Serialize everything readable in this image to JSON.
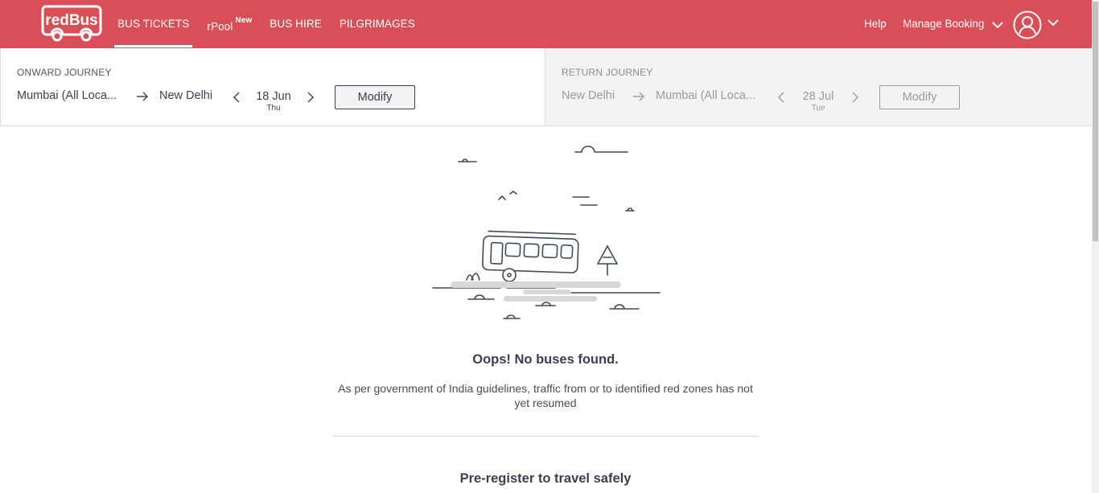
{
  "brand": {
    "logo_text": "redBus",
    "header_color": "#d84f57"
  },
  "nav": {
    "items": [
      {
        "label": "BUS TICKETS",
        "active": true
      },
      {
        "label": "rPool",
        "badge": "New",
        "active": false
      },
      {
        "label": "BUS HIRE",
        "active": false
      },
      {
        "label": "PILGRIMAGES",
        "active": false
      }
    ]
  },
  "header_right": {
    "help": "Help",
    "manage_booking": "Manage Booking",
    "account_icon": "user-avatar-icon"
  },
  "onward": {
    "label": "ONWARD JOURNEY",
    "from": "Mumbai (All Loca...",
    "to": "New Delhi",
    "date": "18 Jun",
    "day": "Thu",
    "modify_label": "Modify"
  },
  "return": {
    "label": "RETURN JOURNEY",
    "from": "New Delhi",
    "to": "Mumbai (All Loca...",
    "date": "28 Jul",
    "day": "Tue",
    "modify_label": "Modify"
  },
  "empty_state": {
    "title": "Oops! No buses found.",
    "message": "As per government of India guidelines, traffic from or to identified red zones has not yet resumed",
    "prereg_title": "Pre-register to travel safely"
  }
}
